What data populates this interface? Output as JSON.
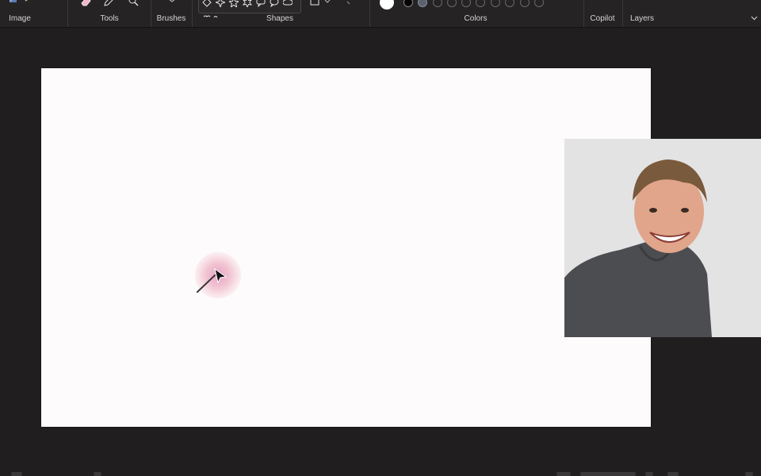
{
  "ribbon": {
    "groups": {
      "image": "Image",
      "tools": "Tools",
      "brushes": "Brushes",
      "shapes": "Shapes",
      "colors": "Colors",
      "copilot": "Copilot",
      "layers": "Layers"
    },
    "icons": [
      "image-select-icon",
      "eraser-icon",
      "pencil-icon",
      "magnifier-icon",
      "brush-icon",
      "diamond-shape-icon",
      "four-point-star-icon",
      "five-point-star-icon",
      "six-point-star-icon",
      "speech-bubble-icon",
      "round-callout-icon",
      "cloud-callout-icon",
      "heart-shape-icon",
      "outline-fill-icon",
      "chevron-down-icon"
    ],
    "colors": {
      "primary": "#ffffff",
      "secondary": "#000000",
      "third": "#5a6270",
      "empty_slots": 8
    }
  },
  "canvas": {
    "background": "#fdfbfc"
  },
  "photo": {
    "subject": "person-photo"
  }
}
